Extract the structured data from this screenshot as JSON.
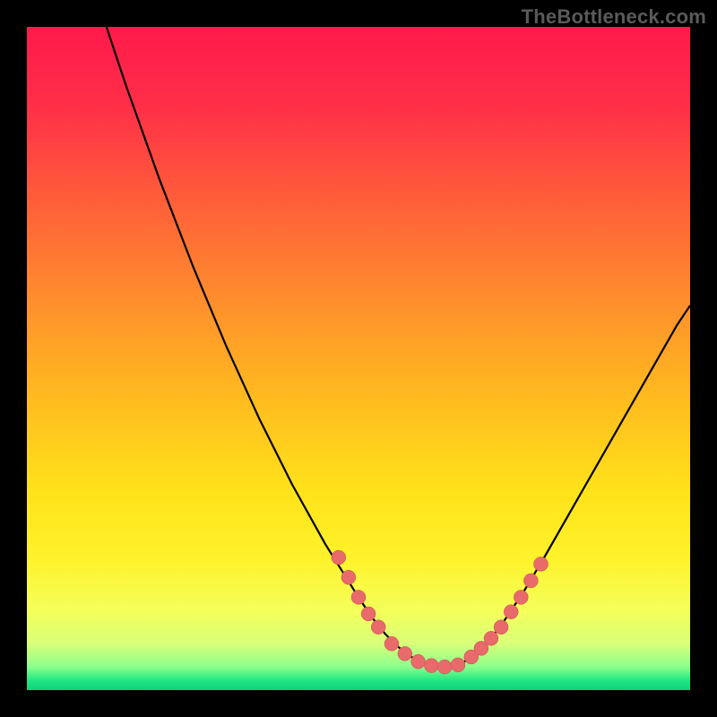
{
  "watermark": "TheBottleneck.com",
  "colors": {
    "background": "#000000",
    "gradient_stops": [
      {
        "offset": 0.0,
        "color": "#ff1a4b"
      },
      {
        "offset": 0.12,
        "color": "#ff2f48"
      },
      {
        "offset": 0.25,
        "color": "#ff5a3a"
      },
      {
        "offset": 0.4,
        "color": "#ff8a2e"
      },
      {
        "offset": 0.55,
        "color": "#ffb81f"
      },
      {
        "offset": 0.7,
        "color": "#ffe21a"
      },
      {
        "offset": 0.8,
        "color": "#fff22a"
      },
      {
        "offset": 0.88,
        "color": "#f4ff5a"
      },
      {
        "offset": 0.93,
        "color": "#d9ff7a"
      },
      {
        "offset": 0.965,
        "color": "#8cff8c"
      },
      {
        "offset": 0.985,
        "color": "#22e884"
      },
      {
        "offset": 1.0,
        "color": "#10d07a"
      }
    ],
    "curve": "#000000",
    "marker_fill": "#e86a6a",
    "marker_stroke": "#c74f4f"
  },
  "chart_data": {
    "type": "line",
    "title": "",
    "xlabel": "",
    "ylabel": "",
    "xlim": [
      0,
      100
    ],
    "ylim": [
      0,
      100
    ],
    "grid": false,
    "legend": false,
    "series": [
      {
        "name": "bottleneck-curve",
        "x": [
          0,
          5,
          10,
          15,
          20,
          25,
          30,
          35,
          40,
          45,
          47.5,
          50,
          52,
          54,
          56,
          58,
          60,
          62,
          64,
          66,
          68,
          70,
          72,
          75,
          78,
          82,
          86,
          90,
          94,
          98,
          100
        ],
        "y": [
          140,
          122,
          106,
          91,
          77,
          64,
          52,
          41,
          31,
          22,
          18,
          14,
          11,
          8.5,
          6.5,
          5,
          4,
          3.5,
          3.6,
          4.3,
          5.8,
          7.8,
          10.5,
          15,
          20,
          27,
          34,
          41,
          48,
          55,
          58
        ]
      }
    ],
    "markers": {
      "name": "highlight-points",
      "x": [
        47,
        48.5,
        50,
        51.5,
        53,
        55,
        57,
        59,
        61,
        63,
        65,
        67,
        68.5,
        70,
        71.5,
        73,
        74.5,
        76,
        77.5
      ],
      "y": [
        20,
        17,
        14,
        11.5,
        9.5,
        7,
        5.5,
        4.3,
        3.7,
        3.5,
        3.8,
        5,
        6.3,
        7.8,
        9.5,
        11.8,
        14,
        16.5,
        19
      ]
    }
  }
}
